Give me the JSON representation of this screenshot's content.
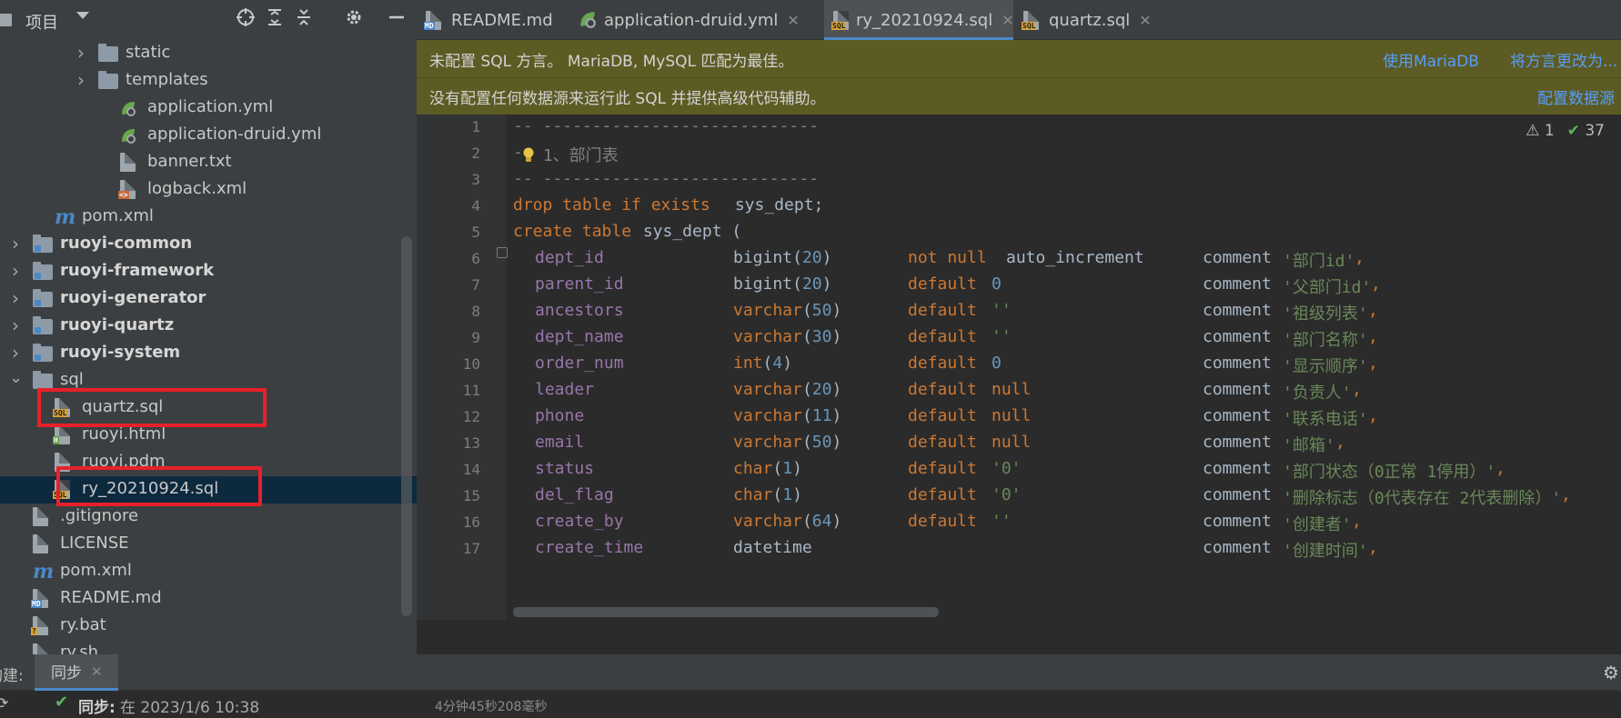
{
  "project": {
    "title": "项目",
    "tree": [
      {
        "label": "static",
        "type": "folder",
        "chevron": true,
        "depth": 4
      },
      {
        "label": "templates",
        "type": "folder",
        "chevron": true,
        "depth": 4
      },
      {
        "label": "application.yml",
        "type": "yml",
        "depth": 5
      },
      {
        "label": "application-druid.yml",
        "type": "yml",
        "depth": 5
      },
      {
        "label": "banner.txt",
        "type": "txt",
        "depth": 5
      },
      {
        "label": "logback.xml",
        "type": "xml",
        "depth": 5
      },
      {
        "label": "pom.xml",
        "type": "maven",
        "depth": 2
      },
      {
        "label": "ruoyi-common",
        "type": "module",
        "chevron": true,
        "depth": 1,
        "bold": true
      },
      {
        "label": "ruoyi-framework",
        "type": "module",
        "chevron": true,
        "depth": 1,
        "bold": true
      },
      {
        "label": "ruoyi-generator",
        "type": "module",
        "chevron": true,
        "depth": 1,
        "bold": true
      },
      {
        "label": "ruoyi-quartz",
        "type": "module",
        "chevron": true,
        "depth": 1,
        "bold": true
      },
      {
        "label": "ruoyi-system",
        "type": "module",
        "chevron": true,
        "depth": 1,
        "bold": true
      },
      {
        "label": "sql",
        "type": "folder",
        "chevron": "open",
        "depth": 1
      },
      {
        "label": "quartz.sql",
        "type": "sql",
        "depth": 2,
        "highlighted": true
      },
      {
        "label": "ruoyi.html",
        "type": "html",
        "depth": 2
      },
      {
        "label": "ruoyi.pdm",
        "type": "txt",
        "depth": 2
      },
      {
        "label": "ry_20210924.sql",
        "type": "sql",
        "depth": 2,
        "selected": true,
        "highlighted": true
      },
      {
        "label": ".gitignore",
        "type": "git",
        "depth": 1
      },
      {
        "label": "LICENSE",
        "type": "txt",
        "depth": 1
      },
      {
        "label": "pom.xml",
        "type": "maven",
        "depth": 1
      },
      {
        "label": "README.md",
        "type": "md",
        "depth": 1
      },
      {
        "label": "ry.bat",
        "type": "bat",
        "depth": 1
      },
      {
        "label": "ry.sh",
        "type": "txt",
        "depth": 1
      }
    ]
  },
  "tabs": [
    {
      "label": "README.md",
      "icon": "md-file-icon",
      "closable": false,
      "active": false
    },
    {
      "label": "application-druid.yml",
      "icon": "yml-file-icon",
      "closable": true,
      "active": false
    },
    {
      "label": "ry_20210924.sql",
      "icon": "sql-file-icon",
      "closable": true,
      "active": true
    },
    {
      "label": "quartz.sql",
      "icon": "sql-file-icon",
      "closable": true,
      "active": false
    }
  ],
  "banner1": {
    "text": "未配置 SQL 方言。 MariaDB, MySQL 匹配为最佳。",
    "link1": "使用MariaDB",
    "link2": "将方言更改为..."
  },
  "banner2": {
    "text": "没有配置任何数据源来运行此 SQL 并提供高级代码辅助。",
    "link1": "配置数据源"
  },
  "inspections": {
    "warnings": "1",
    "ok": "37"
  },
  "code": {
    "line1": "-- ----------------------------",
    "line2_prefix": "-",
    "line2_comment": " 1、部门表",
    "line3": "-- ----------------------------",
    "line4": {
      "kw1": "drop table if exists",
      "rest": " sys_dept;"
    },
    "line5": {
      "kw1": "create table",
      "rest": " sys_dept ("
    },
    "columns": [
      {
        "name": "dept_id",
        "type": "bigint",
        "len": "20",
        "kw": "not null",
        "extra": "auto_increment",
        "comment": "'部门id'"
      },
      {
        "name": "parent_id",
        "type": "bigint",
        "len": "20",
        "kw": "default",
        "extra": "0",
        "comment": "'父部门id'"
      },
      {
        "name": "ancestors",
        "type": "varchar",
        "len": "50",
        "kw": "default",
        "extra": "''",
        "comment": "'祖级列表'"
      },
      {
        "name": "dept_name",
        "type": "varchar",
        "len": "30",
        "kw": "default",
        "extra": "''",
        "comment": "'部门名称'"
      },
      {
        "name": "order_num",
        "type": "int",
        "len": "4",
        "kw": "default",
        "extra": "0",
        "comment": "'显示顺序'"
      },
      {
        "name": "leader",
        "type": "varchar",
        "len": "20",
        "kw": "default",
        "extra": "null",
        "comment": "'负责人'"
      },
      {
        "name": "phone",
        "type": "varchar",
        "len": "11",
        "kw": "default",
        "extra": "null",
        "comment": "'联系电话'"
      },
      {
        "name": "email",
        "type": "varchar",
        "len": "50",
        "kw": "default",
        "extra": "null",
        "comment": "'邮箱'"
      },
      {
        "name": "status",
        "type": "char",
        "len": "1",
        "kw": "default",
        "extra": "'0'",
        "comment": "'部门状态（0正常 1停用）'"
      },
      {
        "name": "del_flag",
        "type": "char",
        "len": "1",
        "kw": "default",
        "extra": "'0'",
        "comment": "'删除标志（0代表存在 2代表删除）'"
      },
      {
        "name": "create_by",
        "type": "varchar",
        "len": "64",
        "kw": "default",
        "extra": "''",
        "comment": "'创建者'"
      },
      {
        "name": "create_time",
        "type": "datetime",
        "len": "",
        "kw": "",
        "extra": "",
        "comment": "'创建时间'"
      }
    ],
    "line_numbers": [
      "1",
      "2",
      "3",
      "4",
      "5",
      "6",
      "7",
      "8",
      "9",
      "10",
      "11",
      "12",
      "13",
      "14",
      "15",
      "16",
      "17"
    ]
  },
  "bottom": {
    "build_label": "构建:",
    "tab": "同步",
    "status_label": "同步:",
    "status_time": "在 2023/1/6 10:38",
    "duration": "4分钟45秒208毫秒"
  }
}
